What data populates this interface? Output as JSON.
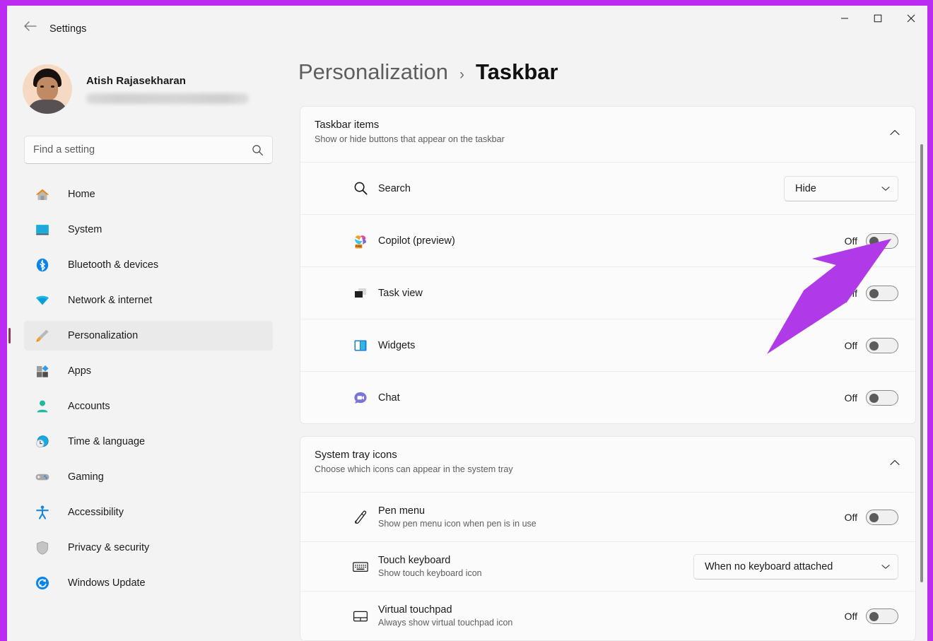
{
  "window": {
    "app_title": "Settings",
    "back_icon": "back-arrow-icon",
    "minimize_label": "Minimize",
    "maximize_label": "Maximize",
    "close_label": "Close",
    "frame_color": "#bb2bf2"
  },
  "account": {
    "name": "Atish Rajasekharan",
    "email_redacted": true
  },
  "search": {
    "placeholder": "Find a setting",
    "value": "",
    "icon": "search-icon"
  },
  "sidebar": {
    "items": [
      {
        "label": "Home",
        "icon": "home-icon",
        "selected": false
      },
      {
        "label": "System",
        "icon": "system-icon",
        "selected": false
      },
      {
        "label": "Bluetooth & devices",
        "icon": "bluetooth-icon",
        "selected": false
      },
      {
        "label": "Network & internet",
        "icon": "wifi-icon",
        "selected": false
      },
      {
        "label": "Personalization",
        "icon": "paintbrush-icon",
        "selected": true
      },
      {
        "label": "Apps",
        "icon": "apps-icon",
        "selected": false
      },
      {
        "label": "Accounts",
        "icon": "person-icon",
        "selected": false
      },
      {
        "label": "Time & language",
        "icon": "clock-globe-icon",
        "selected": false
      },
      {
        "label": "Gaming",
        "icon": "gamepad-icon",
        "selected": false
      },
      {
        "label": "Accessibility",
        "icon": "accessibility-icon",
        "selected": false
      },
      {
        "label": "Privacy & security",
        "icon": "shield-icon",
        "selected": false
      },
      {
        "label": "Windows Update",
        "icon": "update-icon",
        "selected": false
      }
    ]
  },
  "breadcrumb": {
    "parent": "Personalization",
    "separator": "›",
    "current": "Taskbar"
  },
  "sections": [
    {
      "id": "taskbar-items",
      "title": "Taskbar items",
      "subtitle": "Show or hide buttons that appear on the taskbar",
      "expanded": true,
      "collapse_icon": "chevron-up-icon",
      "rows": [
        {
          "label": "Search",
          "desc": "",
          "icon": "search-icon",
          "control": "dropdown",
          "value": "Hide"
        },
        {
          "label": "Copilot (preview)",
          "desc": "",
          "icon": "copilot-icon",
          "control": "toggle",
          "value": "Off"
        },
        {
          "label": "Task view",
          "desc": "",
          "icon": "taskview-icon",
          "control": "toggle",
          "value": "Off"
        },
        {
          "label": "Widgets",
          "desc": "",
          "icon": "widgets-icon",
          "control": "toggle",
          "value": "Off"
        },
        {
          "label": "Chat",
          "desc": "",
          "icon": "chat-icon",
          "control": "toggle",
          "value": "Off"
        }
      ]
    },
    {
      "id": "system-tray-icons",
      "title": "System tray icons",
      "subtitle": "Choose which icons can appear in the system tray",
      "expanded": true,
      "collapse_icon": "chevron-up-icon",
      "rows": [
        {
          "label": "Pen menu",
          "desc": "Show pen menu icon when pen is in use",
          "icon": "pen-icon",
          "control": "toggle",
          "value": "Off"
        },
        {
          "label": "Touch keyboard",
          "desc": "Show touch keyboard icon",
          "icon": "keyboard-icon",
          "control": "dropdown",
          "value": "When no keyboard attached"
        },
        {
          "label": "Virtual touchpad",
          "desc": "Always show virtual touchpad icon",
          "icon": "touchpad-icon",
          "control": "toggle",
          "value": "Off"
        }
      ]
    }
  ],
  "annotation": {
    "type": "arrow",
    "color": "#b03ae8",
    "points_to": "copilot-preview-toggle"
  },
  "scrollbar": {
    "orientation": "vertical",
    "thumb_color": "#8c8c8c"
  }
}
